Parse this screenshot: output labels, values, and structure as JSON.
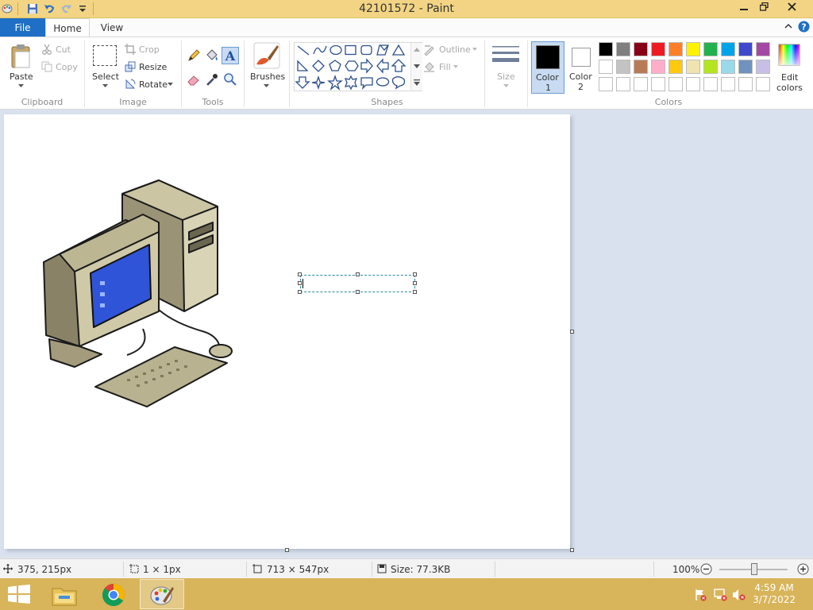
{
  "window": {
    "title": "42101572 - Paint",
    "controls": [
      "minimize",
      "restore",
      "close"
    ]
  },
  "tabs": {
    "file": "File",
    "home": "Home",
    "view": "View"
  },
  "ribbon": {
    "clipboard": {
      "label": "Clipboard",
      "paste": "Paste",
      "cut": "Cut",
      "copy": "Copy"
    },
    "image": {
      "label": "Image",
      "select": "Select",
      "crop": "Crop",
      "resize": "Resize",
      "rotate": "Rotate"
    },
    "tools": {
      "label": "Tools"
    },
    "brushes": {
      "label": "Brushes"
    },
    "shapes": {
      "label": "Shapes",
      "outline": "Outline",
      "fill": "Fill"
    },
    "size": {
      "label": "Size"
    },
    "color1": {
      "label": "Color",
      "num": "1"
    },
    "color2": {
      "label": "Color",
      "num": "2"
    },
    "colors": {
      "label": "Colors",
      "edit": "Edit",
      "edit2": "colors"
    },
    "palette_row1": [
      "#000000",
      "#7f7f7f",
      "#880015",
      "#ed1c24",
      "#ff7f27",
      "#fff200",
      "#22b14c",
      "#00a2e8",
      "#3f48cc",
      "#a349a4"
    ],
    "palette_row2": [
      "#ffffff",
      "#c3c3c3",
      "#b97a57",
      "#ffaec9",
      "#ffc90e",
      "#efe4b0",
      "#b5e61d",
      "#99d9ea",
      "#7092be",
      "#c8bfe7"
    ],
    "palette_row3": [
      "#ffffff",
      "#ffffff",
      "#ffffff",
      "#ffffff",
      "#ffffff",
      "#ffffff",
      "#ffffff",
      "#ffffff",
      "#ffffff",
      "#ffffff"
    ]
  },
  "status": {
    "cursor": "375, 215px",
    "selection": "1 × 1px",
    "canvas_size": "713 × 547px",
    "file_size": "Size: 77.3KB",
    "zoom": "100%"
  },
  "taskbar": {
    "time": "4:59 AM",
    "date": "3/7/2022"
  }
}
